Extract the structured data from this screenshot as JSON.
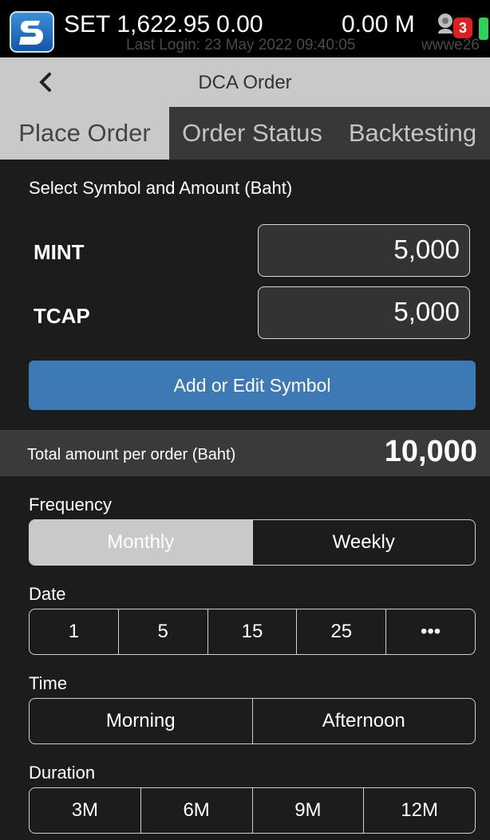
{
  "status_bar": {
    "index_name": "SET",
    "index_value": "1,622.95",
    "index_change": "0.00",
    "volume": "0.00 M",
    "last_login": "Last Login: 23 May 2022 09:40:05",
    "user_tag": "wwwe26",
    "notification_count": "3",
    "battery_color": "#2ed15a"
  },
  "header": {
    "title": "DCA Order",
    "back_icon": "chevron-left-icon"
  },
  "tabs": [
    {
      "label": "Place Order",
      "active": true
    },
    {
      "label": "Order Status",
      "active": false
    },
    {
      "label": "Backtesting",
      "active": false
    }
  ],
  "form": {
    "select_label": "Select Symbol and Amount (Baht)",
    "symbols": [
      {
        "symbol": "MINT",
        "amount": "5,000"
      },
      {
        "symbol": "TCAP",
        "amount": "5,000"
      }
    ],
    "add_button": "Add or Edit Symbol",
    "total_label": "Total amount per order (Baht)",
    "total_value": "10,000",
    "frequency": {
      "label": "Frequency",
      "options": [
        "Monthly",
        "Weekly"
      ],
      "selected": "Monthly"
    },
    "date": {
      "label": "Date",
      "options": [
        "1",
        "5",
        "15",
        "25",
        "•••"
      ]
    },
    "time": {
      "label": "Time",
      "options": [
        "Morning",
        "Afternoon"
      ]
    },
    "duration": {
      "label": "Duration",
      "options": [
        "3M",
        "6M",
        "9M",
        "12M"
      ]
    }
  },
  "colors": {
    "accent_button": "#3d79b5",
    "active_tab": "#c9c9c9",
    "badge": "#e02020"
  }
}
